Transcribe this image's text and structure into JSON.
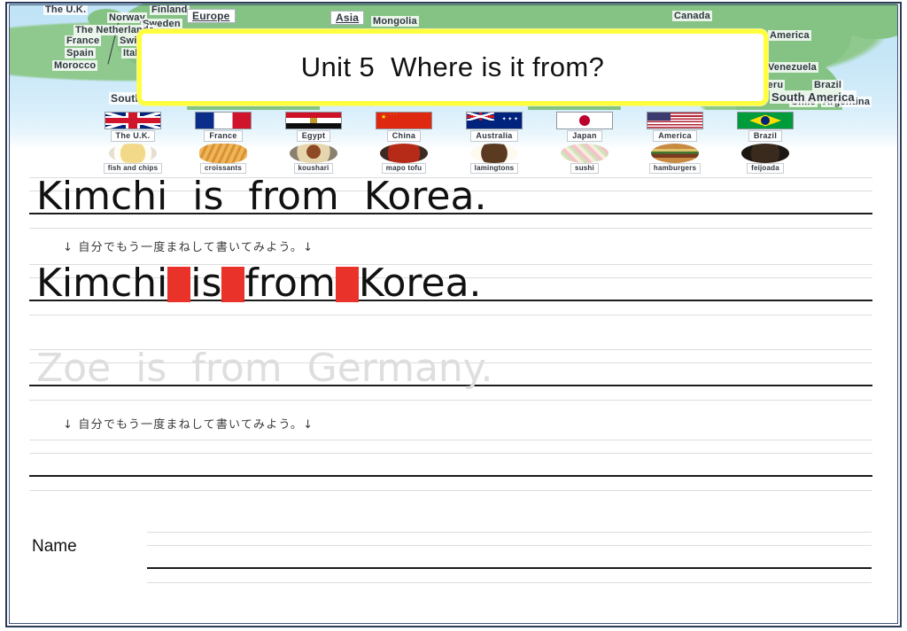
{
  "title": {
    "text": "Unit 5  Where is it from?",
    "border_color": "#ffff3d"
  },
  "map": {
    "region_labels": [
      {
        "name": "Europe",
        "boxed": true
      },
      {
        "name": "Asia",
        "boxed": true
      },
      {
        "name": "South America",
        "boxed": false
      }
    ],
    "country_labels": [
      "The U.K.",
      "Norway",
      "Finland",
      "Sweden",
      "The Netherlands",
      "France",
      "Switzerland",
      "Spain",
      "Italy",
      "Morocco",
      "Mongolia",
      "Canada",
      "America",
      "Venezuela",
      "Peru",
      "Brazil",
      "Chile",
      "Argentina"
    ]
  },
  "countries": [
    {
      "flag": "uk-flag",
      "name": "The U.K.",
      "food": "fish and chips",
      "food_icon": "fish-and-chips-icon"
    },
    {
      "flag": "france-flag",
      "name": "France",
      "food": "croissants",
      "food_icon": "croissants-icon"
    },
    {
      "flag": "egypt-flag",
      "name": "Egypt",
      "food": "koushari",
      "food_icon": "koushari-icon"
    },
    {
      "flag": "china-flag",
      "name": "China",
      "food": "mapo tofu",
      "food_icon": "mapo-tofu-icon"
    },
    {
      "flag": "australia-flag",
      "name": "Australia",
      "food": "lamingtons",
      "food_icon": "lamingtons-icon"
    },
    {
      "flag": "japan-flag",
      "name": "Japan",
      "food": "sushi",
      "food_icon": "sushi-icon"
    },
    {
      "flag": "america-flag",
      "name": "America",
      "food": "hamburgers",
      "food_icon": "hamburgers-icon"
    },
    {
      "flag": "brazil-flag",
      "name": "Brazil",
      "food": "feijoada",
      "food_icon": "feijoada-icon"
    }
  ],
  "worksheet": {
    "model_sentence_1": "Kimchi  is  from  Korea.",
    "practice_sentence_1": {
      "w1": "Kimchi",
      "w2": "is",
      "w3": "from",
      "w4": "Korea."
    },
    "trace_sentence_2": "Zoe  is  from  Germany.",
    "instruction": "↓ 自分でもう一度まねして書いてみよう。↓",
    "practice_sentence_2": "",
    "name_label": "Name",
    "name_value": "",
    "space_marker_color": "#e8322a"
  }
}
